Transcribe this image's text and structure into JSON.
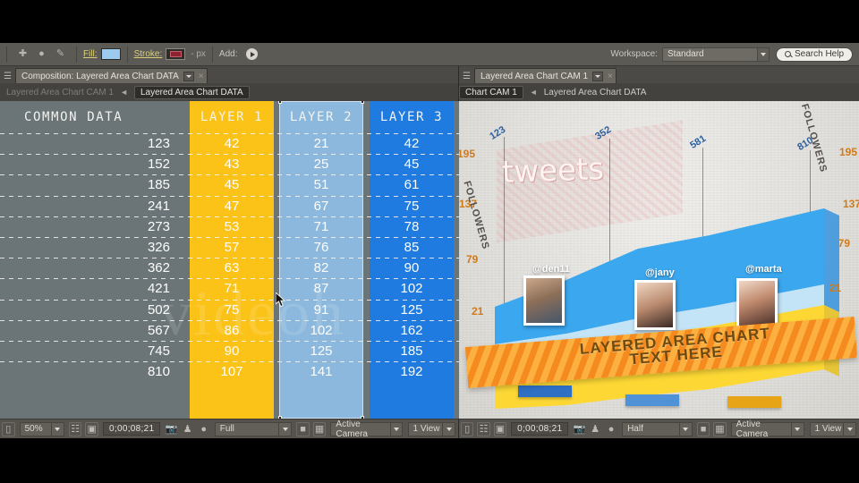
{
  "app": {
    "toolbar": {
      "fill_label": "Fill:",
      "stroke_label": "Stroke:",
      "stroke_width": "- px",
      "add_label": "Add:",
      "workspace_label": "Workspace:",
      "workspace_value": "Standard",
      "search_help": "Search Help",
      "fill_color": "#9ccbee",
      "stroke_color": "#8e2230"
    },
    "left_panel": {
      "tab_label": "Composition: Layered Area Chart DATA",
      "close_label": "×",
      "breadcrumb_dim": "Layered Area Chart CAM 1",
      "breadcrumb_arrow": "◄",
      "breadcrumb_active": "Layered Area Chart DATA",
      "status": {
        "zoom": "50%",
        "timecode": "0;00;08;21",
        "resolution": "Full",
        "view_camera": "Active Camera",
        "view_layout": "1 View"
      }
    },
    "right_panel": {
      "tab_label": "Layered Area Chart CAM 1",
      "close_label": "×",
      "breadcrumb_chip": "Chart CAM 1",
      "breadcrumb_arrow": "◄",
      "breadcrumb_plain": "Layered Area Chart DATA",
      "status": {
        "timecode": "0;00;08;21",
        "resolution": "Half",
        "view_camera": "Active Camera",
        "view_layout": "1 View"
      }
    }
  },
  "chart_data": {
    "type": "table",
    "title": "Layered Area Chart DATA",
    "columns": [
      "COMMON DATA",
      "LAYER 1",
      "LAYER 2",
      "LAYER 3"
    ],
    "column_colors": [
      "#6b7578",
      "#fbc318",
      "#8bb8dc",
      "#1f7be0"
    ],
    "categories": [
      123,
      152,
      185,
      241,
      273,
      326,
      362,
      421,
      502,
      567,
      745,
      810
    ],
    "series": [
      {
        "name": "LAYER 1",
        "color": "#fbc318",
        "values": [
          42,
          43,
          45,
          47,
          53,
          57,
          63,
          71,
          75,
          86,
          90,
          107
        ]
      },
      {
        "name": "LAYER 2",
        "color": "#8bb8dc",
        "values": [
          21,
          25,
          51,
          67,
          71,
          76,
          82,
          87,
          91,
          102,
          125,
          141
        ]
      },
      {
        "name": "LAYER 3",
        "color": "#1f7be0",
        "values": [
          42,
          45,
          61,
          75,
          78,
          85,
          90,
          102,
          125,
          162,
          185,
          192
        ]
      }
    ],
    "rows": [
      {
        "common": "123",
        "l1": "42",
        "l2": "21",
        "l3": "42"
      },
      {
        "common": "152",
        "l1": "43",
        "l2": "25",
        "l3": "45"
      },
      {
        "common": "185",
        "l1": "45",
        "l2": "51",
        "l3": "61"
      },
      {
        "common": "241",
        "l1": "47",
        "l2": "67",
        "l3": "75"
      },
      {
        "common": "273",
        "l1": "53",
        "l2": "71",
        "l3": "78"
      },
      {
        "common": "326",
        "l1": "57",
        "l2": "76",
        "l3": "85"
      },
      {
        "common": "362",
        "l1": "63",
        "l2": "82",
        "l3": "90"
      },
      {
        "common": "421",
        "l1": "71",
        "l2": "87",
        "l3": "102"
      },
      {
        "common": "502",
        "l1": "75",
        "l2": "91",
        "l3": "125"
      },
      {
        "common": "567",
        "l1": "86",
        "l2": "102",
        "l3": "162"
      },
      {
        "common": "745",
        "l1": "90",
        "l2": "125",
        "l3": "185"
      },
      {
        "common": "810",
        "l1": "107",
        "l2": "141",
        "l3": "192"
      }
    ],
    "watermark": "videoh"
  },
  "preview": {
    "headline": "tweets",
    "top_labels": [
      "123",
      "352",
      "581",
      "810"
    ],
    "left_axis_numbers": [
      "195",
      "137",
      "79",
      "21"
    ],
    "right_axis_numbers": [
      "195",
      "137",
      "79",
      "21"
    ],
    "axis_title_left": "FOLLOWERS",
    "axis_title_right": "FOLLOWERS",
    "usernames": [
      "@den11",
      "@jany",
      "@marta"
    ],
    "banner_line1": "LAYERED AREA CHART",
    "banner_line2": "TEXT HERE",
    "area_colors": [
      "#fdd835",
      "#bfe0f5",
      "#3aa7ef",
      "#1f8ae0"
    ]
  }
}
